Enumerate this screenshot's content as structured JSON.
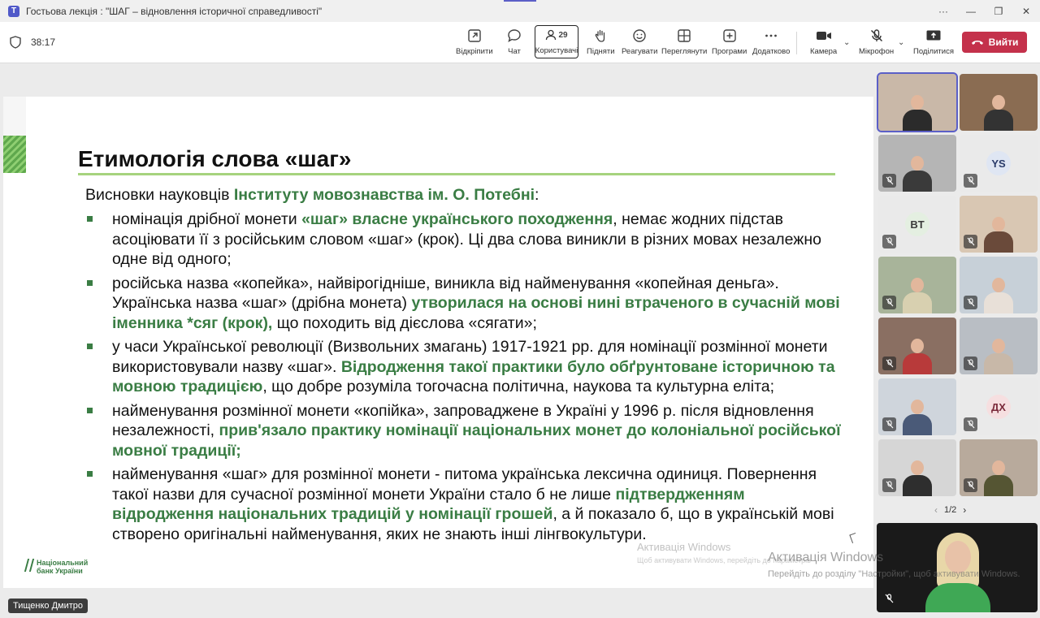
{
  "window": {
    "title": "Гостьова лекція : \"ШАГ – відновлення історичної справедливості\"",
    "more": "···",
    "minimize": "—",
    "restore": "❐",
    "close": "✕"
  },
  "toolbar": {
    "timer": "38:17",
    "items": {
      "popout": "Відкріпити",
      "chat": "Чат",
      "people": "Користувачі",
      "people_count": "29",
      "raise": "Підняти",
      "react": "Реагувати",
      "view": "Переглянути",
      "apps": "Програми",
      "more": "Додатково",
      "camera": "Камера",
      "mic": "Мікрофон",
      "share": "Поділитися"
    },
    "leave_label": "Вийти"
  },
  "slide": {
    "title": "Етимологія слова «шаг»",
    "intro_plain": "Висновки науковців ",
    "intro_green": "Інституту мовознавства ім. О. Потебні",
    "intro_tail": ":",
    "bullets": [
      {
        "p1": "номінація дрібної монети ",
        "g1": "«шаг» власне українського походження",
        "p2": ", немає жодних підстав асоціювати її з російським словом «шаг» (крок). Ці два слова виникли в різних мовах незалежно одне від одного;"
      },
      {
        "p1": "російська назва «копейка», найвірогідніше, виникла від найменування «копейная деньга». Українська назва «шаг» (дрібна монета) ",
        "g1": "утворилася на основі нині втраченого в сучасній мові іменника *сяг (крок),",
        "p2": " що походить від дієслова «сягати»;"
      },
      {
        "p1": "у часи Української революції (Визвольних змагань) 1917-1921 рр. для номінації розмінної монети використовували назву «шаг». ",
        "g1": "Відродження такої практики було обґрунтоване історичною та мовною традицією",
        "p2": ", що добре розуміла тогочасна політична, наукова та культурна еліта;"
      },
      {
        "p1": "найменування розмінної монети «копійка», запроваджене в Україні у 1996 р. після відновлення незалежності, ",
        "g1": "прив'язало практику номінації національних монет до колоніальної російської мовної традиції;",
        "p2": ""
      },
      {
        "p1": "найменування «шаг» для розмінної монети - питома українська лексична одиниця. Повернення такої назви для сучасної розмінної монети України стало б не лише ",
        "g1": "підтвердженням відродження національних традицій у номінації грошей",
        "p2": ", а й показало б, що в українській мові створено оригінальні найменування, яких не знають інші лінгвокультури."
      }
    ],
    "logo_line1": "Національний",
    "logo_line2": "банк України",
    "watermark1": "Активація Windows",
    "watermark2": "Щоб активувати Windows, перейдіть до параметрів"
  },
  "presenter_name": "Тищенко Дмитро",
  "participants": {
    "tiles": [
      {
        "type": "video",
        "initials": ""
      },
      {
        "type": "video",
        "initials": ""
      },
      {
        "type": "video",
        "initials": ""
      },
      {
        "type": "initials",
        "initials": "YS"
      },
      {
        "type": "initials",
        "initials": "BT"
      },
      {
        "type": "video",
        "initials": ""
      },
      {
        "type": "video",
        "initials": ""
      },
      {
        "type": "video",
        "initials": ""
      },
      {
        "type": "video",
        "initials": ""
      },
      {
        "type": "video",
        "initials": ""
      },
      {
        "type": "video",
        "initials": ""
      },
      {
        "type": "initials",
        "initials": "ДХ"
      },
      {
        "type": "video",
        "initials": ""
      },
      {
        "type": "video",
        "initials": ""
      }
    ],
    "page": "1/2"
  },
  "activation": {
    "title": "Активація Windows",
    "text": "Перейдіть до розділу \"Настройки\", щоб активувати Windows."
  },
  "colors": {
    "accent": "#5b5fc7",
    "leave": "#c4314b",
    "slide_green": "#3a7d44",
    "rule_green": "#a6d37e"
  }
}
